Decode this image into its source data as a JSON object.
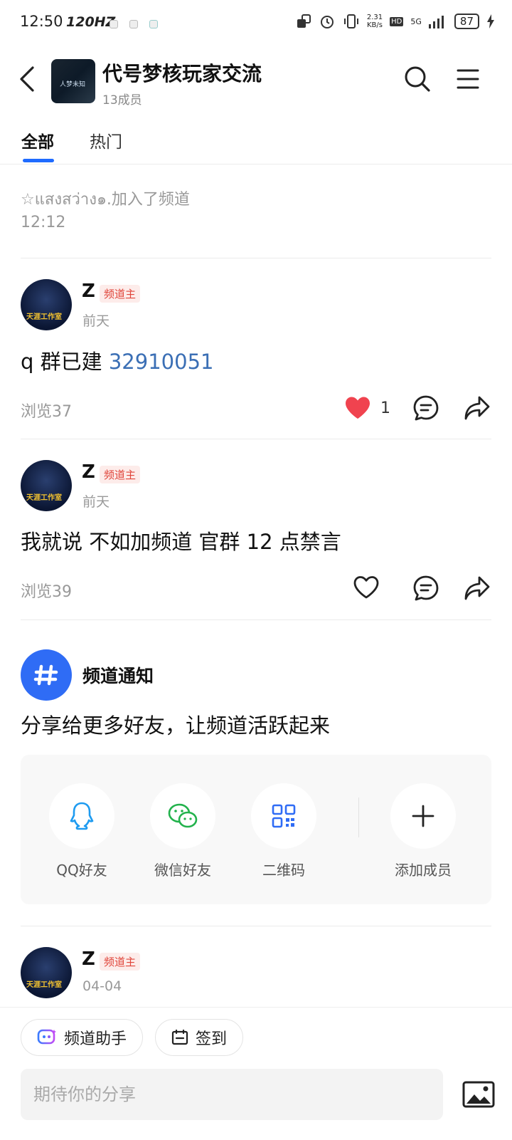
{
  "status_bar": {
    "time": "12:50",
    "refresh": "120HZ",
    "speed": "2.31\nKB/s",
    "network": "5G",
    "battery": "87"
  },
  "header": {
    "title": "代号梦核玩家交流",
    "members": "13成员",
    "avatar_text": "人梦未知"
  },
  "tabs": [
    {
      "label": "全部"
    },
    {
      "label": "热门"
    }
  ],
  "system_message": {
    "text": "☆แสงสว่าง๑.加入了频道",
    "time": "12:12"
  },
  "posts": [
    {
      "author": "Z",
      "badge": "频道主",
      "time": "前天",
      "text": "q 群已建 ",
      "link": "32910051",
      "views": "浏览37",
      "likes": "1",
      "avatar_text": "天涯工作室"
    },
    {
      "author": "Z",
      "badge": "频道主",
      "time": "前天",
      "text": "我就说 不如加频道 官群 12 点禁言",
      "views": "浏览39",
      "avatar_text": "天涯工作室"
    },
    {
      "author": "Z",
      "badge": "频道主",
      "time": "04-04",
      "avatar_text": "天涯工作室"
    }
  ],
  "notice": {
    "title": "频道通知",
    "text": "分享给更多好友，让频道活跃起来"
  },
  "share": [
    {
      "label": "QQ好友",
      "icon": "qq-icon"
    },
    {
      "label": "微信好友",
      "icon": "wechat-icon"
    },
    {
      "label": "二维码",
      "icon": "qrcode-icon"
    },
    {
      "label": "添加成员",
      "icon": "plus-icon"
    }
  ],
  "bottom": {
    "assistant": "频道助手",
    "checkin": "签到",
    "placeholder": "期待你的分享"
  },
  "colors": {
    "accent": "#1f6bff",
    "like": "#f0434f",
    "badge": "#e0453a"
  }
}
